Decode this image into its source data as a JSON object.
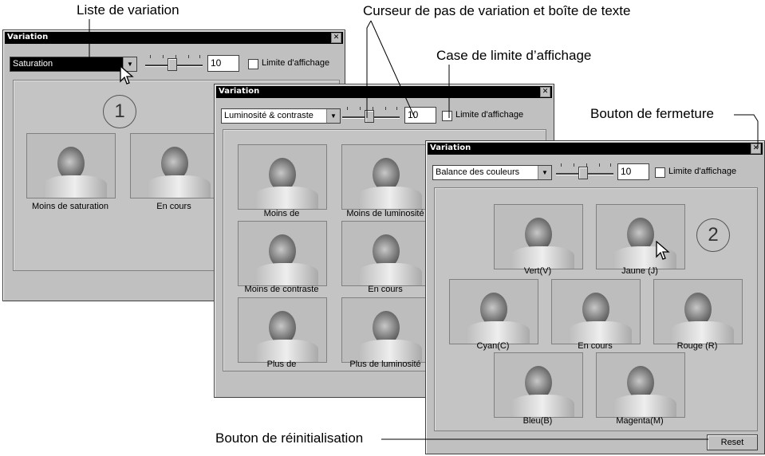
{
  "callouts": {
    "list": "Liste de variation",
    "slider": "Curseur de pas de variation et boîte de texte",
    "limit": "Case de limite d’affichage",
    "close": "Bouton de fermeture",
    "reset": "Bouton de réinitialisation"
  },
  "win1": {
    "title": "Variation",
    "close_glyph": "✕",
    "dropdown_value": "Saturation",
    "arrow": "▼",
    "step_value": "10",
    "limit_label": "Limite d'affichage",
    "badge": "1",
    "captions": [
      "Moins de saturation",
      "En cours"
    ]
  },
  "win2": {
    "title": "Variation",
    "close_glyph": "✕",
    "dropdown_value": "Luminosité & contraste",
    "arrow": "▼",
    "step_value": "10",
    "limit_label": "Limite d'affichage",
    "captions": [
      "Moins de",
      "Moins de luminosité",
      "Moins de contraste",
      "En cours",
      "Plus de",
      "Plus de luminosité"
    ]
  },
  "win3": {
    "title": "Variation",
    "close_glyph": "✕",
    "dropdown_value": "Balance des couleurs",
    "arrow": "▼",
    "step_value": "10",
    "limit_label": "Limite d'affichage",
    "badge": "2",
    "captions": [
      "Vert(V)",
      "Jaune (J)",
      "Cyan(C)",
      "En cours",
      "Rouge (R)",
      "Bleu(B)",
      "Magenta(M)"
    ],
    "reset_label": "Reset"
  },
  "icons": {
    "arrow_cursor": "arrow-cursor-icon",
    "dropdown": "chevron-down-icon",
    "close": "close-icon"
  }
}
